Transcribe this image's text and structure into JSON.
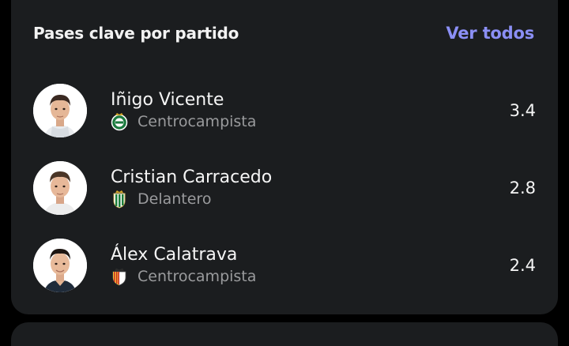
{
  "card": {
    "title": "Pases clave por partido",
    "see_all_label": "Ver todos"
  },
  "players": [
    {
      "name": "Iñigo Vicente",
      "position": "Centrocampista",
      "value": "3.4",
      "club_badge_icon": "racing-santander-crest-icon"
    },
    {
      "name": "Cristian Carracedo",
      "position": "Delantero",
      "value": "2.8",
      "club_badge_icon": "cordoba-crest-icon"
    },
    {
      "name": "Álex Calatrava",
      "position": "Centrocampista",
      "value": "2.4",
      "club_badge_icon": "castellon-crest-icon"
    }
  ],
  "colors": {
    "background": "#000000",
    "card": "#1b1d1f",
    "accent": "#8b8ff5",
    "text_primary": "#f5f5f5",
    "text_secondary": "#9a9b9d"
  }
}
